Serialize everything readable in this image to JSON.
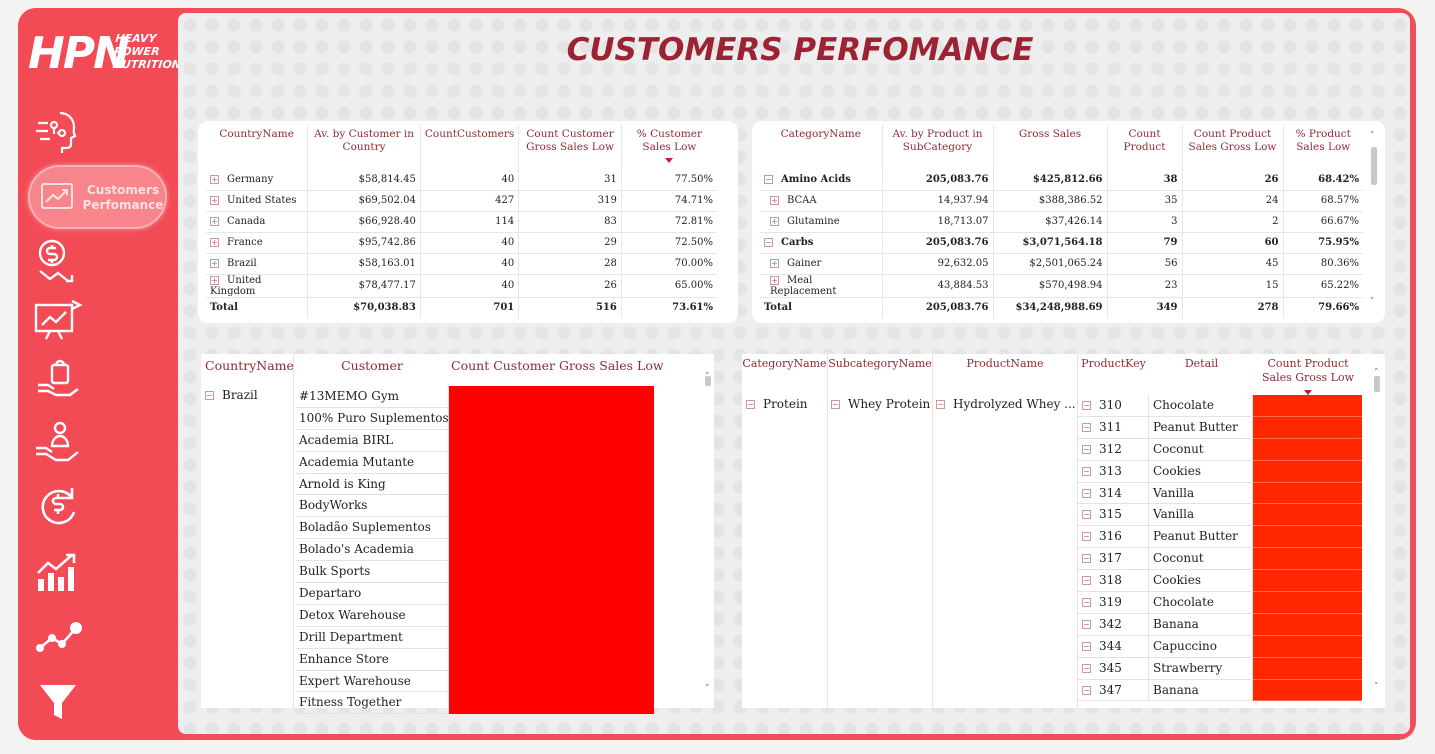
{
  "brand": {
    "logo_main": "HPN",
    "logo_sub1": "HEAVY",
    "logo_sub2": "POWER",
    "logo_sub3": "NUTRITION",
    "accent": "#f24b55",
    "title_color": "#9b2333"
  },
  "page_title": "CUSTOMERS PERFOMANCE",
  "nav": {
    "active_label": "Customers Perfomance",
    "icons": [
      "ai-head-icon",
      "customers-chart-icon",
      "money-down-icon",
      "monitor-chart-icon",
      "shopping-bag-hand-icon",
      "person-hand-icon",
      "cycle-dollar-icon",
      "growth-bars-icon",
      "line-nodes-icon",
      "funnel-icon"
    ]
  },
  "country_table": {
    "headers": [
      "CountryName",
      "Av. by Customer in Country",
      "CountCustomers",
      "Count Customer Gross Sales Low",
      "% Customer Sales Low"
    ],
    "rows": [
      [
        "Germany",
        "$58,814.45",
        "40",
        "31",
        "77.50%"
      ],
      [
        "United States",
        "$69,502.04",
        "427",
        "319",
        "74.71%"
      ],
      [
        "Canada",
        "$66,928.40",
        "114",
        "83",
        "72.81%"
      ],
      [
        "France",
        "$95,742.86",
        "40",
        "29",
        "72.50%"
      ],
      [
        "Brazil",
        "$58,163.01",
        "40",
        "28",
        "70.00%"
      ],
      [
        "United Kingdom",
        "$78,477.17",
        "40",
        "26",
        "65.00%"
      ]
    ],
    "total": [
      "Total",
      "$70,038.83",
      "701",
      "516",
      "73.61%"
    ]
  },
  "category_table": {
    "headers": [
      "CategoryName",
      "Av. by Product in SubCategory",
      "Gross Sales",
      "Count Product",
      "Count Product Sales Gross Low",
      "% Product Sales Low"
    ],
    "rows": [
      {
        "level": 0,
        "sign": "−",
        "cells": [
          "Amino Acids",
          "205,083.76",
          "$425,812.66",
          "38",
          "26",
          "68.42%"
        ]
      },
      {
        "level": 1,
        "sign": "+",
        "cells": [
          "BCAA",
          "14,937.94",
          "$388,386.52",
          "35",
          "24",
          "68.57%"
        ]
      },
      {
        "level": 1,
        "sign": "+",
        "cells": [
          "Glutamine",
          "18,713.07",
          "$37,426.14",
          "3",
          "2",
          "66.67%"
        ]
      },
      {
        "level": 0,
        "sign": "−",
        "cells": [
          "Carbs",
          "205,083.76",
          "$3,071,564.18",
          "79",
          "60",
          "75.95%"
        ]
      },
      {
        "level": 1,
        "sign": "+",
        "cells": [
          "Gainer",
          "92,632.05",
          "$2,501,065.24",
          "56",
          "45",
          "80.36%"
        ]
      },
      {
        "level": 1,
        "sign": "+",
        "cells": [
          "Meal Replacement",
          "43,884.53",
          "$570,498.94",
          "23",
          "15",
          "65.22%"
        ]
      }
    ],
    "total": [
      "Total",
      "205,083.76",
      "$34,248,988.69",
      "349",
      "278",
      "79.66%"
    ]
  },
  "customer_matrix": {
    "headers": [
      "CountryName",
      "Customer",
      "Count Customer Gross Sales Low"
    ],
    "country": "Brazil",
    "customers": [
      "#13MEMO Gym",
      "100% Puro Suplementos",
      "Academia BIRL",
      "Academia Mutante",
      "Arnold is King",
      "BodyWorks",
      "Boladão Suplementos",
      "Bolado's Academia",
      "Bulk Sports",
      "Departaro",
      "Detox Warehouse",
      "Drill Department",
      "Enhance Store",
      "Expert Warehouse",
      "Fitness Together"
    ]
  },
  "product_matrix": {
    "headers": [
      "CategoryName",
      "SubcategoryName",
      "ProductName",
      "ProductKey",
      "Detail",
      "Count Product Sales Gross Low"
    ],
    "category": "Protein",
    "subcategory": "Whey Protein",
    "product": "Hydrolyzed Whey ...",
    "rows": [
      [
        "310",
        "Chocolate"
      ],
      [
        "311",
        "Peanut Butter"
      ],
      [
        "312",
        "Coconut"
      ],
      [
        "313",
        "Cookies"
      ],
      [
        "314",
        "Vanilla"
      ],
      [
        "315",
        "Vanilla"
      ],
      [
        "316",
        "Peanut Butter"
      ],
      [
        "317",
        "Coconut"
      ],
      [
        "318",
        "Cookies"
      ],
      [
        "319",
        "Chocolate"
      ],
      [
        "342",
        "Banana"
      ],
      [
        "344",
        "Capuccino"
      ],
      [
        "345",
        "Strawberry"
      ],
      [
        "347",
        "Banana"
      ]
    ]
  }
}
